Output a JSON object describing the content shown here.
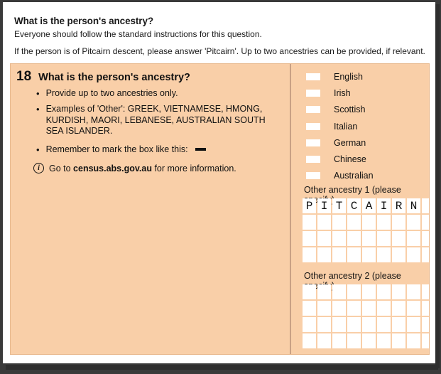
{
  "intro": {
    "title": "What is the person's ancestry?",
    "subtitle": "Everyone should follow the standard instructions for this question.",
    "note": "If the person is of Pitcairn descent, please answer 'Pitcairn'. Up to two ancestries can be provided, if relevant."
  },
  "question": {
    "number": "18",
    "text": "What is the person's ancestry?",
    "bullets": [
      "Provide up to two ancestries only.",
      "Examples of 'Other': GREEK, VIETNAMESE, HMONG, KURDISH, MAORI, LEBANESE, AUSTRALIAN SOUTH SEA ISLANDER.",
      "Remember to mark the box like this:"
    ],
    "mark_example": "—",
    "info": {
      "icon": "info-circle-icon",
      "prefix": "Go to ",
      "url": "census.abs.gov.au",
      "suffix": " for more information."
    }
  },
  "checkboxes": [
    {
      "label": "English",
      "checked": false
    },
    {
      "label": "Irish",
      "checked": false
    },
    {
      "label": "Scottish",
      "checked": false
    },
    {
      "label": "Italian",
      "checked": false
    },
    {
      "label": "German",
      "checked": false
    },
    {
      "label": "Chinese",
      "checked": false
    },
    {
      "label": "Australian",
      "checked": false
    }
  ],
  "other_ancestry_1": {
    "label": "Other ancestry 1 (please specify)",
    "columns": 9,
    "rows": 4,
    "value": "PITCAIRN"
  },
  "other_ancestry_2": {
    "label": "Other ancestry 2 (please specify)",
    "columns": 9,
    "rows": 4,
    "value": ""
  },
  "colors": {
    "form_background": "#f9cfa8",
    "form_border": "#e8b98e",
    "divider": "#c9a184",
    "cell_background": "#ffffff",
    "page_frame": "#3a3a3a",
    "text": "#111111"
  }
}
